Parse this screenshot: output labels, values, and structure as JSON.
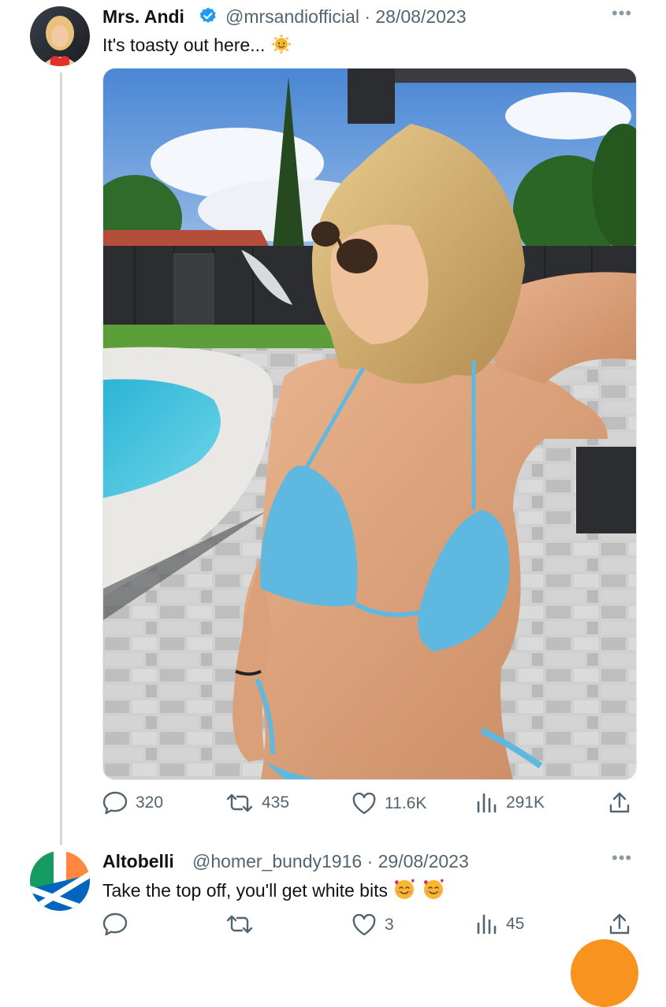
{
  "tweet": {
    "author_name": "Mrs. Andi",
    "handle": "@mrsandiofficial",
    "separator": "·",
    "date": "28/08/2023",
    "text": "It's toasty out here...",
    "emoji_icon": "sun-face-icon",
    "verified": true,
    "actions": {
      "replies": "320",
      "retweets": "435",
      "likes": "11.6K",
      "views": "291K"
    }
  },
  "reply": {
    "author_name": "Altobelli",
    "handle": "@homer_bundy1916",
    "separator": "·",
    "date": "29/08/2023",
    "text": "Take the top off, you'll get white bits",
    "emoji_icons": [
      "smiling-face-with-hearts-icon",
      "smiling-face-with-hearts-icon"
    ],
    "actions": {
      "replies": "",
      "retweets": "",
      "likes": "3",
      "views": "45"
    }
  },
  "colors": {
    "text_primary": "#0f1419",
    "text_secondary": "#536471",
    "verified_blue": "#1d9bf0",
    "thread_line": "#cfd9de",
    "accent_orange": "#f7931e"
  }
}
